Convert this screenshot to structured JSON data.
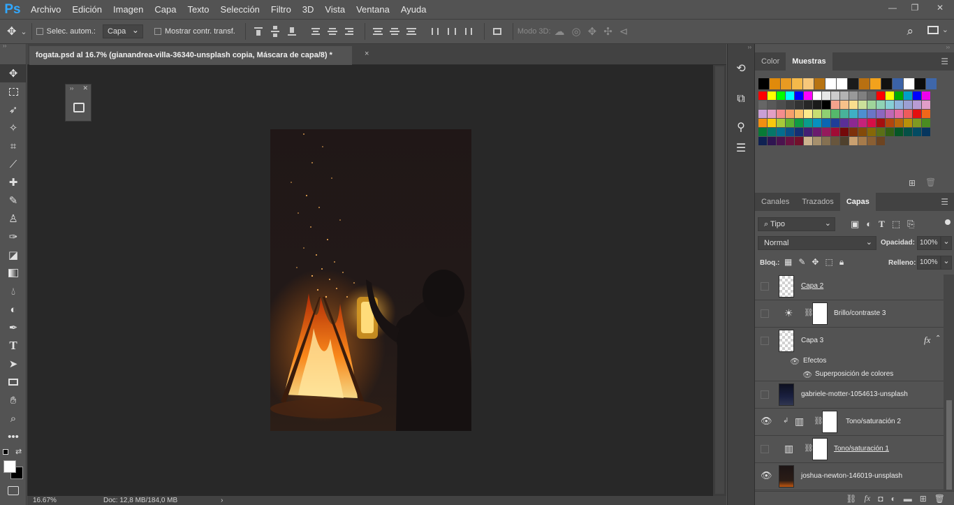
{
  "app": {
    "logo": "Ps"
  },
  "menu": [
    "Archivo",
    "Edición",
    "Imagen",
    "Capa",
    "Texto",
    "Selección",
    "Filtro",
    "3D",
    "Vista",
    "Ventana",
    "Ayuda"
  ],
  "window_controls": {
    "minimize": "—",
    "restore": "❐",
    "close": "✕"
  },
  "options": {
    "auto_select_label": "Selec. autom.:",
    "auto_select_target": "Capa",
    "show_transform_label": "Mostrar contr. transf.",
    "mode3d_label": "Modo 3D:"
  },
  "document": {
    "tab_title": "fogata.psd al 16.7% (gianandrea-villa-36340-unsplash copia, Máscara de capa/8) *",
    "close": "×"
  },
  "status": {
    "zoom": "16.67%",
    "doc": "Doc: 12,8 MB/184,0 MB",
    "arrow": "›"
  },
  "color_panel": {
    "tabs": [
      "Color",
      "Muestras"
    ],
    "active_tab": "Muestras",
    "recent_swatches": [
      "#000000",
      "#e08a0b",
      "#e89a22",
      "#f4b94a",
      "#f7c77a",
      "#b77312",
      "#ffffff",
      "#ffffff",
      "#1b1b1b",
      "#b87011",
      "#f2a21c",
      "#111111",
      "#3b62a6",
      "#ffffff",
      "#0d0d0d",
      "#3f67aa"
    ],
    "swatch_rows": [
      [
        "#ff0000",
        "#ffff00",
        "#00ff00",
        "#00ffff",
        "#0000ff",
        "#ff00ff",
        "#ffffff",
        "#e6e6e6",
        "#cccccc",
        "#b3b3b3",
        "#999999",
        "#808080",
        "#666666",
        "#ff0000",
        "#ffff00",
        "#00aa00",
        "#00a0c8",
        "#0000ff",
        "#ee00ee"
      ],
      [
        "#666666",
        "#595959",
        "#4d4d4d",
        "#404040",
        "#333333",
        "#262626",
        "#1a1a1a",
        "#000000",
        "#f4a28c",
        "#f6c18a",
        "#f9de8e",
        "#cbe09a",
        "#9fd49a",
        "#8fd3b5",
        "#86cfd6",
        "#8fb4dd",
        "#9c9fd3",
        "#b89bd3",
        "#e09dc8"
      ],
      [
        "#c99fd6",
        "#e29fc4",
        "#f48d8d",
        "#f5a06b",
        "#f8c36a",
        "#fce98b",
        "#c8dd71",
        "#8fcf72",
        "#55b86b",
        "#48b39a",
        "#3fb0c4",
        "#4d8fd0",
        "#6a76c6",
        "#8c67c0",
        "#c068b5",
        "#e56aa0",
        "#ee5b5b",
        "#e30f0f",
        "#f0671a"
      ],
      [
        "#f28f11",
        "#f7c90d",
        "#a7c93a",
        "#5cb132",
        "#0e9b44",
        "#0a9c8d",
        "#0591bf",
        "#0a66b3",
        "#1f3e98",
        "#5a2f98",
        "#8d2891",
        "#c6227a",
        "#d70f47",
        "#a40f0f",
        "#b1460e",
        "#b6670b",
        "#b8910a",
        "#7f9a22",
        "#4a8d21"
      ],
      [
        "#087a36",
        "#067669",
        "#046d8f",
        "#0a4e87",
        "#152f73",
        "#431f73",
        "#6a1b6e",
        "#951a5c",
        "#a10c35",
        "#740a0a",
        "#7d300a",
        "#834a09",
        "#866808",
        "#5a6f17",
        "#335f15",
        "#055626",
        "#045046",
        "#034b62",
        "#06365e"
      ],
      [
        "#0f2152",
        "#2f1551",
        "#4b134e",
        "#6a1241",
        "#72102b",
        "#cdb48f",
        "#a6906d",
        "#857152",
        "#68563d",
        "#4f412d",
        "#c9a070",
        "#a67b4b",
        "#8a5f33",
        "#6d4421"
      ]
    ]
  },
  "layers_panel": {
    "tabs": [
      "Canales",
      "Trazados",
      "Capas"
    ],
    "active_tab": "Capas",
    "filter": "Tipo",
    "blend_mode": "Normal",
    "opacity_label": "Opacidad:",
    "opacity": "100%",
    "lock_label": "Bloq.:",
    "fill_label": "Relleno:",
    "fill": "100%",
    "layers": [
      {
        "name": "Capa 2",
        "visible": false,
        "fx": false
      },
      {
        "name": "Brillo/contraste 3",
        "visible": false,
        "fx": false
      },
      {
        "name": "Capa 3",
        "visible": false,
        "fx": true
      },
      {
        "name": "gabriele-motter-1054613-unsplash",
        "visible": false,
        "fx": false
      },
      {
        "name": "Tono/saturación 2",
        "visible": true,
        "fx": false
      },
      {
        "name": "Tono/saturación 1",
        "visible": false,
        "fx": false
      },
      {
        "name": "joshua-newton-146019-unsplash",
        "visible": true,
        "fx": false
      }
    ],
    "effects_label": "Efectos",
    "effect_item": "Superposición de colores",
    "fx_symbol": "fx"
  }
}
